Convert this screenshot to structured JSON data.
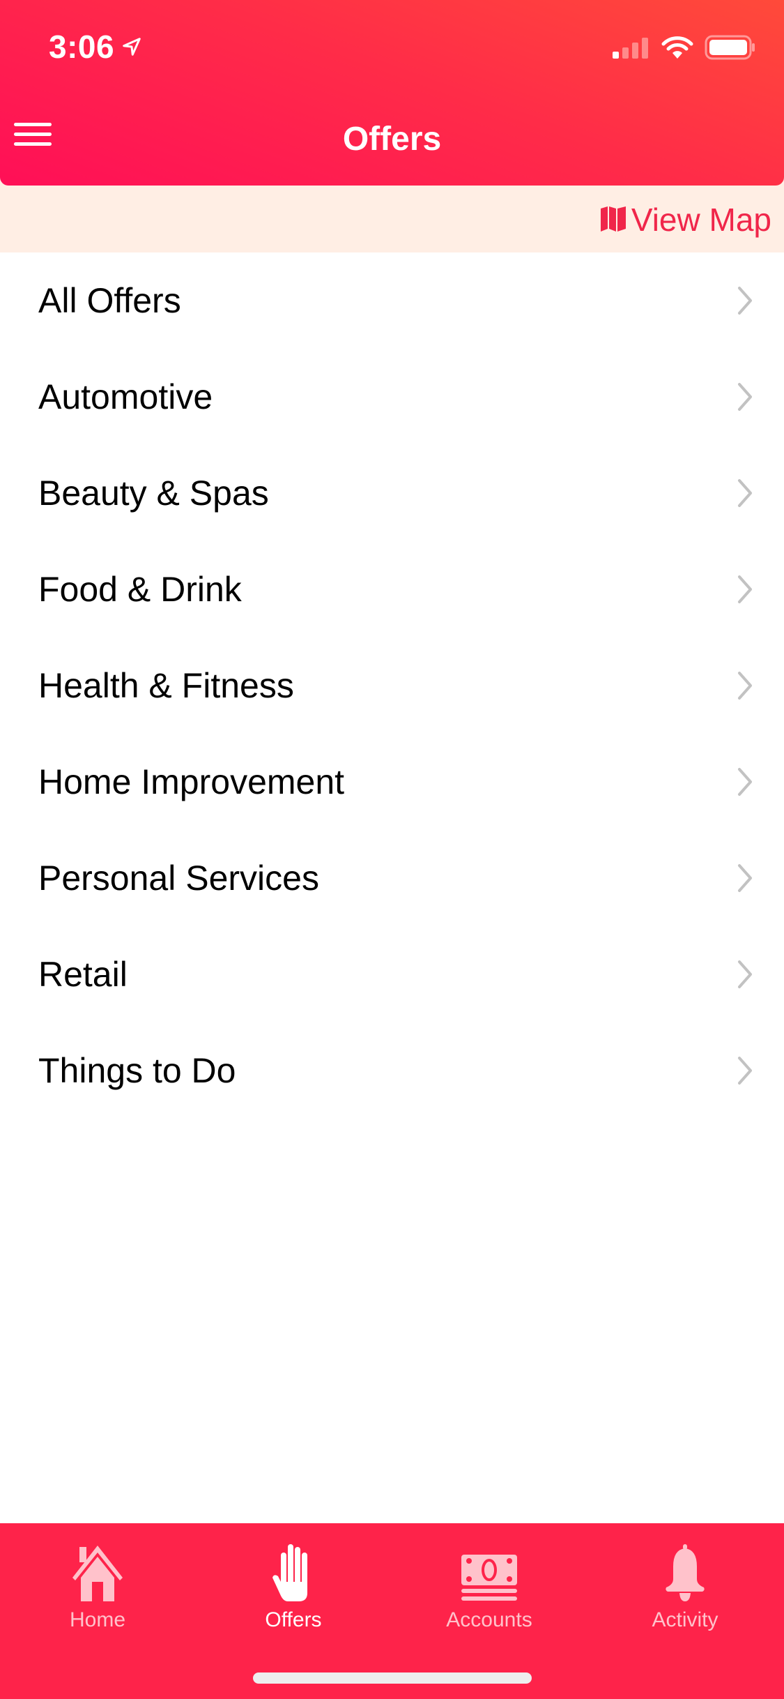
{
  "status_bar": {
    "time": "3:06",
    "location_icon": "location-arrow-icon",
    "signal_icon": "cellular-signal-icon",
    "wifi_icon": "wifi-icon",
    "battery_icon": "battery-icon"
  },
  "header": {
    "title": "Offers",
    "menu_icon": "hamburger-menu-icon",
    "gradient_colors": [
      "#ff0f57",
      "#ff4a3a"
    ]
  },
  "map_bar": {
    "label": "View Map",
    "icon": "map-icon",
    "background": "#ffeee4",
    "accent": "#f0264a"
  },
  "categories": [
    {
      "label": "All Offers"
    },
    {
      "label": "Automotive"
    },
    {
      "label": "Beauty & Spas"
    },
    {
      "label": "Food & Drink"
    },
    {
      "label": "Health & Fitness"
    },
    {
      "label": "Home Improvement"
    },
    {
      "label": "Personal Services"
    },
    {
      "label": "Retail"
    },
    {
      "label": "Things to Do"
    }
  ],
  "tab_bar": {
    "background": "#fe234a",
    "active": "Offers",
    "tabs": [
      {
        "label": "Home",
        "icon": "home-icon"
      },
      {
        "label": "Offers",
        "icon": "hand-icon"
      },
      {
        "label": "Accounts",
        "icon": "cash-icon"
      },
      {
        "label": "Activity",
        "icon": "bell-icon"
      }
    ]
  }
}
